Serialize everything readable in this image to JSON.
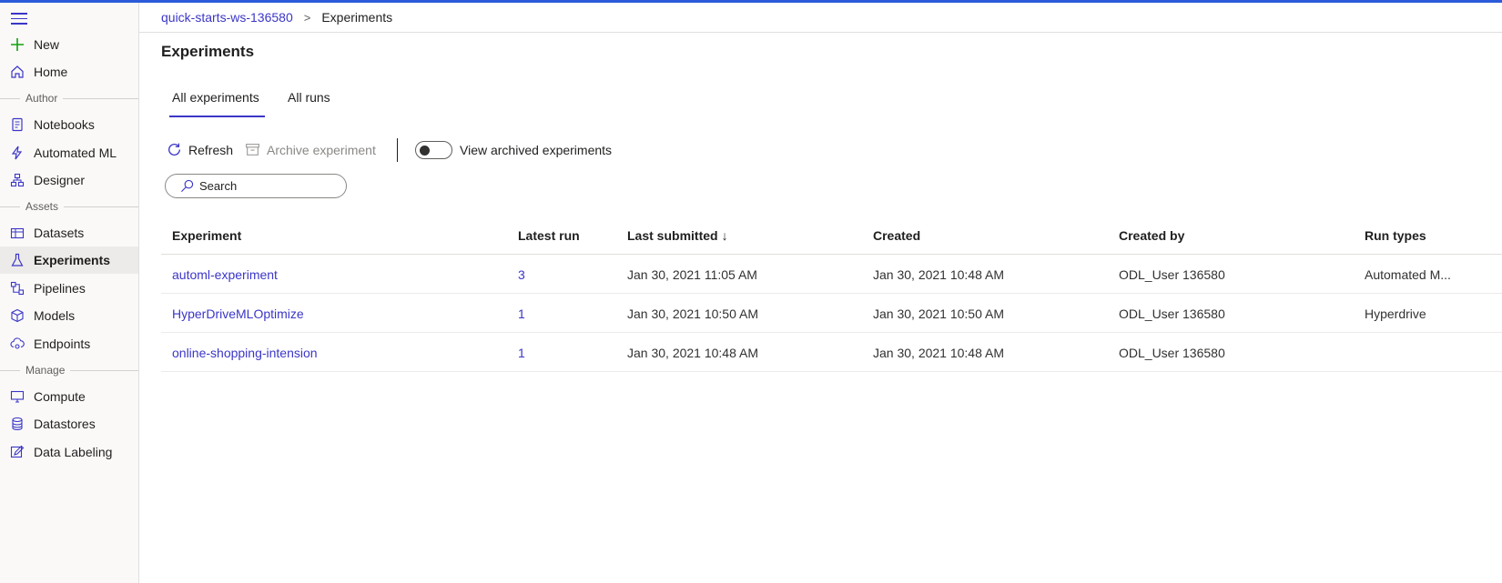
{
  "breadcrumb": {
    "workspace": "quick-starts-ws-136580",
    "separator": ">",
    "current": "Experiments"
  },
  "sidebar": {
    "top_items": [
      {
        "label": "New",
        "icon": "plus-icon"
      },
      {
        "label": "Home",
        "icon": "home-icon"
      }
    ],
    "sections": {
      "author": "Author",
      "assets": "Assets",
      "manage": "Manage"
    },
    "author_items": [
      {
        "label": "Notebooks",
        "icon": "notebook-icon"
      },
      {
        "label": "Automated ML",
        "icon": "automl-icon"
      },
      {
        "label": "Designer",
        "icon": "designer-icon"
      }
    ],
    "assets_items": [
      {
        "label": "Datasets",
        "icon": "datasets-icon"
      },
      {
        "label": "Experiments",
        "icon": "flask-icon"
      },
      {
        "label": "Pipelines",
        "icon": "pipelines-icon"
      },
      {
        "label": "Models",
        "icon": "models-icon"
      },
      {
        "label": "Endpoints",
        "icon": "endpoints-icon"
      }
    ],
    "manage_items": [
      {
        "label": "Compute",
        "icon": "compute-icon"
      },
      {
        "label": "Datastores",
        "icon": "datastores-icon"
      },
      {
        "label": "Data Labeling",
        "icon": "data-labeling-icon"
      }
    ]
  },
  "page": {
    "title": "Experiments"
  },
  "tabs": [
    {
      "label": "All experiments"
    },
    {
      "label": "All runs"
    }
  ],
  "toolbar": {
    "refresh_label": "Refresh",
    "archive_label": "Archive experiment",
    "toggle_label": "View archived experiments",
    "toggle_on": false
  },
  "search": {
    "placeholder": "Search"
  },
  "table": {
    "headers": [
      "Experiment",
      "Latest run",
      "Last submitted",
      "Created",
      "Created by",
      "Run types"
    ],
    "sort_indicator": "↓",
    "rows": [
      [
        "automl-experiment",
        "3",
        "Jan 30, 2021 11:05 AM",
        "Jan 30, 2021 10:48 AM",
        "ODL_User 136580",
        "Automated M..."
      ],
      [
        "HyperDriveMLOptimize",
        "1",
        "Jan 30, 2021 10:50 AM",
        "Jan 30, 2021 10:50 AM",
        "ODL_User 136580",
        "Hyperdrive"
      ],
      [
        "online-shopping-intension",
        "1",
        "Jan 30, 2021 10:48 AM",
        "Jan 30, 2021 10:48 AM",
        "ODL_User 136580",
        ""
      ]
    ]
  },
  "colors": {
    "accent": "#3b36c7",
    "topbar": "#2b5bd8",
    "new_plus": "#13a10e"
  }
}
